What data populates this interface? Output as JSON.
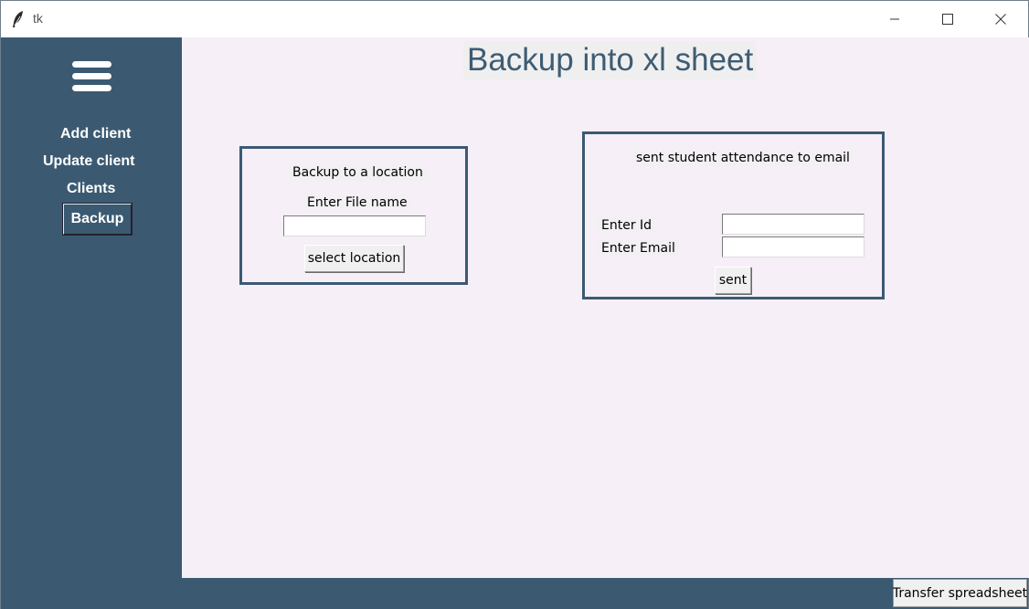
{
  "window": {
    "title": "tk",
    "app_icon": "feather-icon",
    "controls": {
      "minimize": "minimize-icon",
      "maximize": "maximize-icon",
      "close": "close-icon"
    }
  },
  "colors": {
    "sidebar": "#3b5a72",
    "main_background": "#f6eff7",
    "title_text": "#3e5c73",
    "nav_text": "#ffffff"
  },
  "sidebar": {
    "menu_icon": "hamburger-menu-icon",
    "items": [
      {
        "label": "Add client"
      },
      {
        "label": "Update client"
      },
      {
        "label": "Clients"
      },
      {
        "label": "Backup",
        "active": true
      }
    ]
  },
  "main": {
    "title": "Backup into xl sheet",
    "backup_panel": {
      "heading": "Backup to a location",
      "filename_label": "Enter File name",
      "filename_value": "",
      "select_button": "select location"
    },
    "email_panel": {
      "heading": "sent student attendance to email",
      "id_label": "Enter Id",
      "id_value": "",
      "email_label": "Enter Email",
      "email_value": "",
      "send_button": "sent"
    }
  },
  "bottom_bar": {
    "transfer_button": "Transfer spreadsheet"
  }
}
